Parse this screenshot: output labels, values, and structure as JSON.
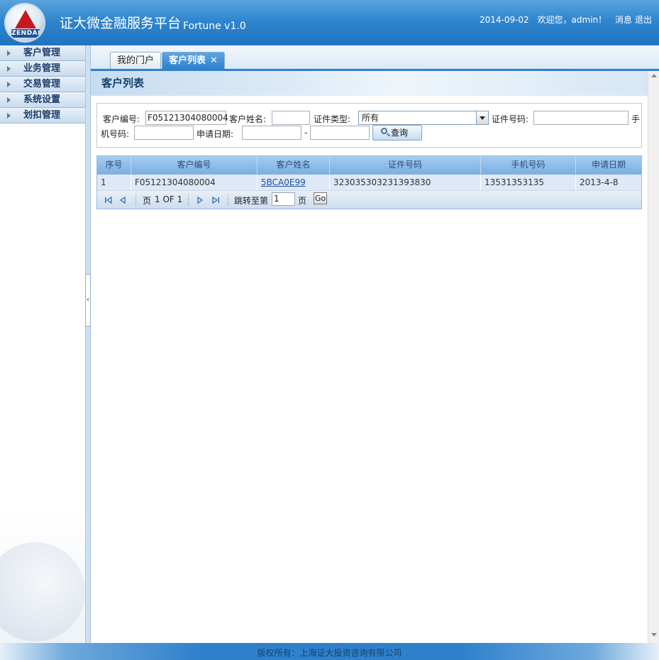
{
  "header": {
    "logo_text": "ZENDAI",
    "title": "证大微金融服务平台",
    "version": "Fortune v1.0",
    "date": "2014-09-02",
    "welcome": "欢迎您，admin！",
    "messages": "消息",
    "logout": "退出"
  },
  "sidebar": {
    "items": [
      {
        "label": "客户管理"
      },
      {
        "label": "业务管理"
      },
      {
        "label": "交易管理"
      },
      {
        "label": "系统设置"
      },
      {
        "label": "划扣管理"
      }
    ]
  },
  "tabs": {
    "home": "我的门户",
    "active": "客户列表",
    "close": "✕"
  },
  "panel": {
    "title": "客户列表"
  },
  "search": {
    "customer_no_label": "客户编号:",
    "customer_no_value": "F05121304080004",
    "customer_name_label": "客户姓名:",
    "customer_name_value": "",
    "id_type_label": "证件类型:",
    "id_type_value": "所有",
    "id_no_label": "证件号码:",
    "id_no_value": "",
    "phone_label_part1": "手",
    "phone_label_part2": "机号码:",
    "phone_value": "",
    "date_label": "申请日期:",
    "date_from": "",
    "date_sep": "-",
    "date_to": "",
    "query_button": "查询"
  },
  "grid": {
    "columns": [
      "序号",
      "客户编号",
      "客户姓名",
      "证件号码",
      "手机号码",
      "申请日期"
    ],
    "rows": [
      {
        "index": "1",
        "customer_no": "F05121304080004",
        "name": "5BCA0E99",
        "id_no": "323035303231393830",
        "phone": "13531353135",
        "date": "2013-4-8"
      }
    ]
  },
  "pager": {
    "page_label": "页",
    "page_info": "1 OF 1",
    "jump_label": "跳转至第",
    "jump_value": "1",
    "page_suffix": "页",
    "go": "Go"
  },
  "footer": {
    "copyright": "版权所有：上海证大投资咨询有限公司"
  }
}
